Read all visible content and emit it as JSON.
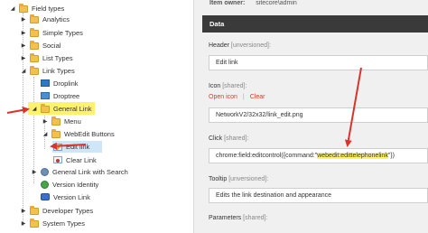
{
  "tree": {
    "items": [
      {
        "label": "Field types",
        "icon": "folder-icon",
        "expanded": true
      },
      {
        "label": "Analytics",
        "icon": "folder-icon",
        "expanded": false
      },
      {
        "label": "Simple Types",
        "icon": "folder-icon",
        "expanded": false
      },
      {
        "label": "Social",
        "icon": "folder-icon",
        "expanded": false
      },
      {
        "label": "List Types",
        "icon": "folder-icon",
        "expanded": false
      },
      {
        "label": "Link Types",
        "icon": "folder-icon",
        "expanded": true
      },
      {
        "label": "Droplink",
        "icon": "field-type-icon",
        "expanded": null
      },
      {
        "label": "Droptree",
        "icon": "field-type-icon",
        "expanded": null
      },
      {
        "label": "General Link",
        "icon": "folder-icon",
        "expanded": true,
        "highlighted": true
      },
      {
        "label": "Menu",
        "icon": "folder-icon",
        "expanded": false
      },
      {
        "label": "WebEdit Buttons",
        "icon": "folder-icon",
        "expanded": true
      },
      {
        "label": "Edit link",
        "icon": "edit-link-icon",
        "expanded": null,
        "selected": true
      },
      {
        "label": "Clear Link",
        "icon": "clear-link-icon",
        "expanded": null
      },
      {
        "label": "General Link with Search",
        "icon": "gear-icon",
        "expanded": false
      },
      {
        "label": "Version Identity",
        "icon": "version-icon",
        "expanded": null
      },
      {
        "label": "Version Link",
        "icon": "version-link-icon",
        "expanded": null
      },
      {
        "label": "Developer Types",
        "icon": "folder-icon",
        "expanded": false
      },
      {
        "label": "System Types",
        "icon": "folder-icon",
        "expanded": false
      }
    ]
  },
  "content": {
    "owner_label": "Item owner:",
    "owner_value": "sitecore\\admin",
    "section_title": "Data",
    "header_label": "Header",
    "header_tag": "[unversioned]:",
    "header_value": "Edit link",
    "icon_label": "Icon",
    "icon_tag": "[shared]:",
    "open_icon": "Open icon",
    "clear": "Clear",
    "separator": "|",
    "icon_value": "NetworkV2/32x32/link_edit.png",
    "click_label": "Click",
    "click_tag": "[shared]:",
    "click_value_before": "chrome:field:editcontrol({command:\"",
    "click_value_highlight": "webedit:edittelephonelink",
    "click_value_after": "\"})",
    "tooltip_label": "Tooltip",
    "tooltip_tag": "[unversioned]:",
    "tooltip_value": "Edits the link destination and appearance",
    "parameters_label": "Parameters",
    "parameters_tag": "[shared]:"
  },
  "colors": {
    "highlight": "#fff36b",
    "annotation_arrow": "#d9342b",
    "section_bar": "#3a3a3a",
    "link": "#c8442a"
  }
}
